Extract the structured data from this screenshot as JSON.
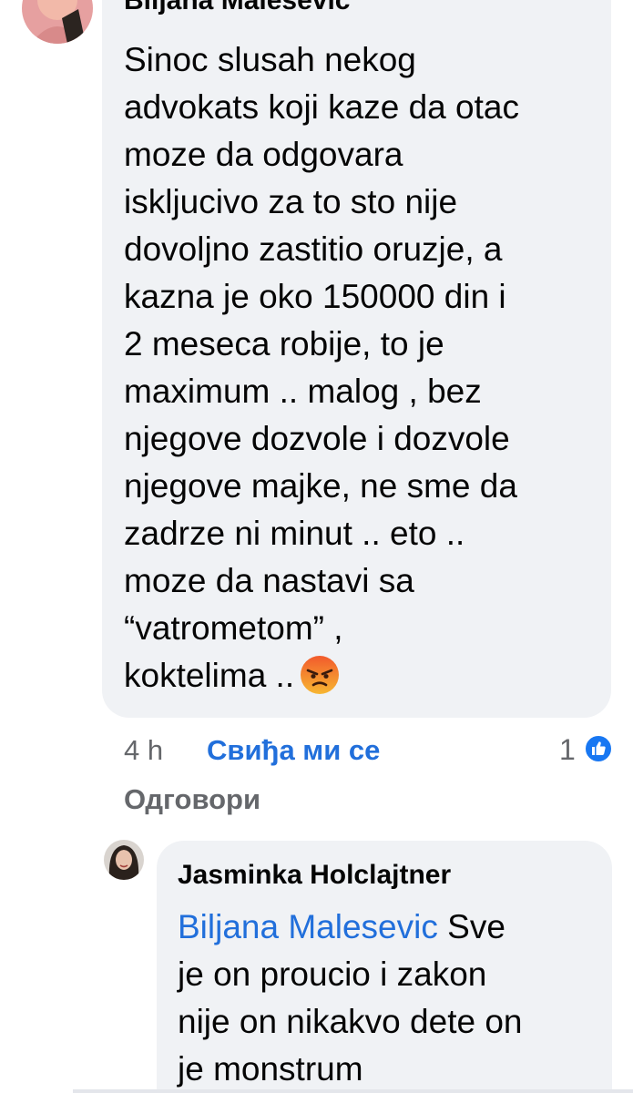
{
  "comment": {
    "author": "Biljana Malesevic",
    "lines": [
      "Sinoc slusah nekog",
      "advokats koji kaze da otac",
      "moze da odgovara",
      "iskljucivo za to sto nije",
      "dovoljno zastitio oruzje, a",
      "kazna je oko 150000 din i",
      "2 meseca robije, to je",
      "maximum .. malog , bez",
      "njegove dozvole i dozvole",
      "njegove majke, ne sme da",
      "zadrze ni minut .. eto ..",
      "moze da nastavi sa",
      "“vatrometom” ,",
      "koktelima .."
    ],
    "emoji": "angry-face",
    "timestamp": "4 h",
    "like_label": "Свиђа ми се",
    "reply_label": "Одговори",
    "reaction_count": "1",
    "reaction_type": "like"
  },
  "reply": {
    "author": "Jasminka Holclajtner",
    "mention": "Biljana Malesevic",
    "first_line_rest": " Sve",
    "lines": [
      "je on proucio i zakon",
      "nije on nikakvo dete on",
      "je monstrum"
    ]
  },
  "colors": {
    "bubble_bg": "#f0f2f5",
    "link_blue": "#216fdb",
    "meta_gray": "#65676b",
    "text": "#050505"
  }
}
